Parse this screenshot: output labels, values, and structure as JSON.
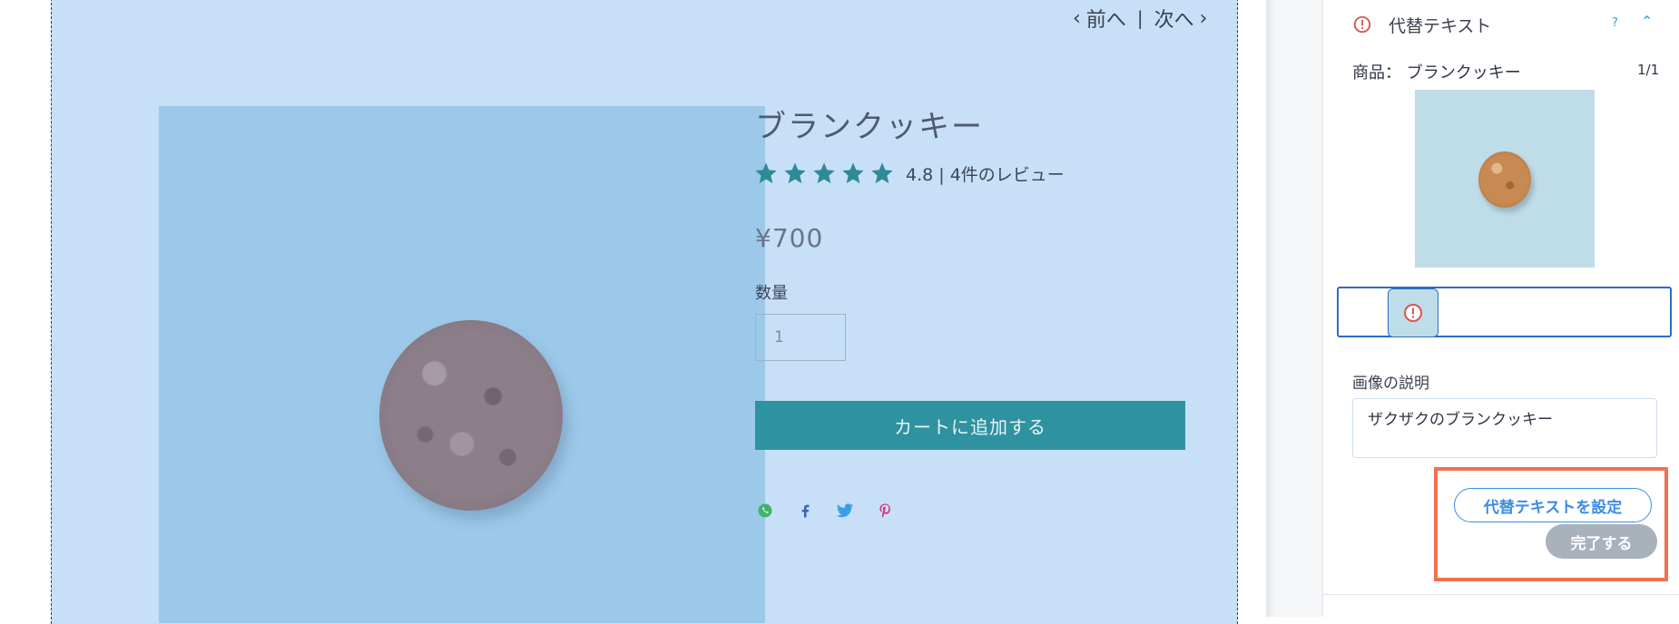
{
  "canvas": {
    "pager": {
      "prev_label": "前へ",
      "next_label": "次へ",
      "separator": "|"
    },
    "product": {
      "title": "ブランクッキー",
      "rating": {
        "stars": 5,
        "value": "4.8",
        "reviews_text": "4.8 | 4件のレビュー"
      },
      "price": "¥700",
      "quantity_label": "数量",
      "quantity_value": "1",
      "add_to_cart_label": "カートに追加する",
      "share_icons": [
        "whatsapp-icon",
        "facebook-icon",
        "twitter-icon",
        "pinterest-icon"
      ]
    },
    "accent_color": "#2f92a0"
  },
  "panel": {
    "title": "代替テキスト",
    "help_label": "?",
    "product_label": "商品： ブランクッキー",
    "counter": "1/1",
    "description_label": "画像の説明",
    "description_value": "ザクザクのブランクッキー",
    "set_alt_text_label": "代替テキストを設定",
    "done_label": "完了する",
    "warning_color": "#d9534f",
    "highlight_color": "#f0704f"
  }
}
